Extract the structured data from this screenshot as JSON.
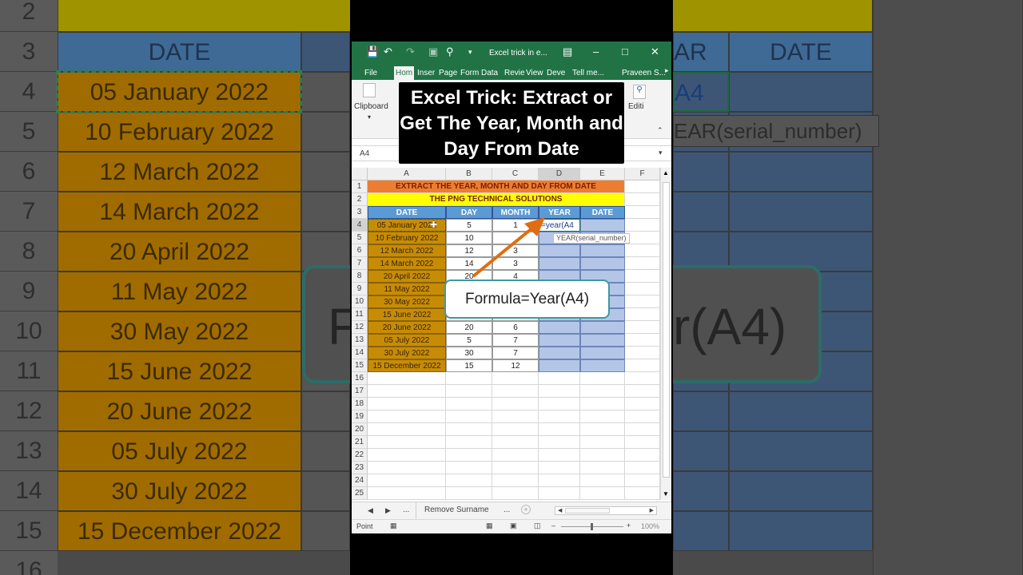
{
  "background": {
    "title_fragment": "THE PN",
    "header_left": "DATE",
    "header_mid": "AR",
    "header_right": "DATE",
    "row_numbers": [
      "2",
      "3",
      "4",
      "5",
      "6",
      "7",
      "8",
      "9",
      "10",
      "11",
      "12",
      "13",
      "14",
      "15",
      "16"
    ],
    "dates": [
      "05 January 2022",
      "10 February 2022",
      "12 March 2022",
      "14 March 2022",
      "20 April 2022",
      "11 May 2022",
      "30 May 2022",
      "15 June 2022",
      "20 June 2022",
      "05 July 2022",
      "30 July 2022",
      "15 December 2022"
    ],
    "formula_fragment": "A4",
    "tooltip_fragment": "EAR(serial_number)",
    "callout_left": "F",
    "callout_right": "r(A4)"
  },
  "excel": {
    "doc_title": "Excel trick in e...",
    "tabs": [
      "File",
      "Hom",
      "Inser",
      "Page",
      "Form",
      "Data",
      "Revie",
      "View",
      "Deve",
      "Tell me...",
      "Praveen S..."
    ],
    "active_tab": "Hom",
    "ribbon": {
      "clipboard": "Clipboard",
      "editing": "Editi"
    },
    "name_box": "A4",
    "columns": [
      "A",
      "B",
      "C",
      "D",
      "E",
      "F"
    ],
    "row_numbers": [
      "1",
      "2",
      "3",
      "4",
      "5",
      "6",
      "7",
      "8",
      "9",
      "10",
      "11",
      "12",
      "13",
      "14",
      "15",
      "16",
      "17",
      "18",
      "19",
      "20",
      "21",
      "22",
      "23",
      "24",
      "25"
    ],
    "title_row": "EXTRACT THE YEAR, MONTH AND DAY FROM DATE",
    "subtitle_row": "THE PNG TECHNICAL SOLUTIONS",
    "headers": [
      "DATE",
      "DAY",
      "MONTH",
      "YEAR",
      "DATE"
    ],
    "rows": [
      {
        "date": "05 January 2022",
        "day": "5",
        "month": "1",
        "year": "=year(A4"
      },
      {
        "date": "10 February 2022",
        "day": "10",
        "month": "",
        "year": ""
      },
      {
        "date": "12 March 2022",
        "day": "12",
        "month": "3",
        "year": ""
      },
      {
        "date": "14 March 2022",
        "day": "14",
        "month": "3",
        "year": ""
      },
      {
        "date": "20 April 2022",
        "day": "20",
        "month": "4",
        "year": ""
      },
      {
        "date": "11 May 2022",
        "day": "",
        "month": "",
        "year": ""
      },
      {
        "date": "30 May 2022",
        "day": "",
        "month": "",
        "year": ""
      },
      {
        "date": "15 June 2022",
        "day": "",
        "month": "",
        "year": ""
      },
      {
        "date": "20 June 2022",
        "day": "20",
        "month": "6",
        "year": ""
      },
      {
        "date": "05 July 2022",
        "day": "5",
        "month": "7",
        "year": ""
      },
      {
        "date": "30 July 2022",
        "day": "30",
        "month": "7",
        "year": ""
      },
      {
        "date": "15 December 2022",
        "day": "15",
        "month": "12",
        "year": ""
      }
    ],
    "tooltip": "YEAR(serial_number)",
    "sheet_name": "Remove Surname",
    "sheet_more": "...",
    "status": "Point",
    "zoom": "100%"
  },
  "overlay": {
    "headline": "Excel Trick: Extract or Get The Year, Month and Day From Date",
    "callout": "Formula=Year(A4)"
  },
  "colors": {
    "excel_green": "#217346",
    "orange": "#ed7d31",
    "yellow": "#ffff00",
    "header_blue": "#5b9bd5",
    "date_gold": "#c78c06",
    "year_blue": "#b4c6e7",
    "arrow": "#e06d10"
  }
}
